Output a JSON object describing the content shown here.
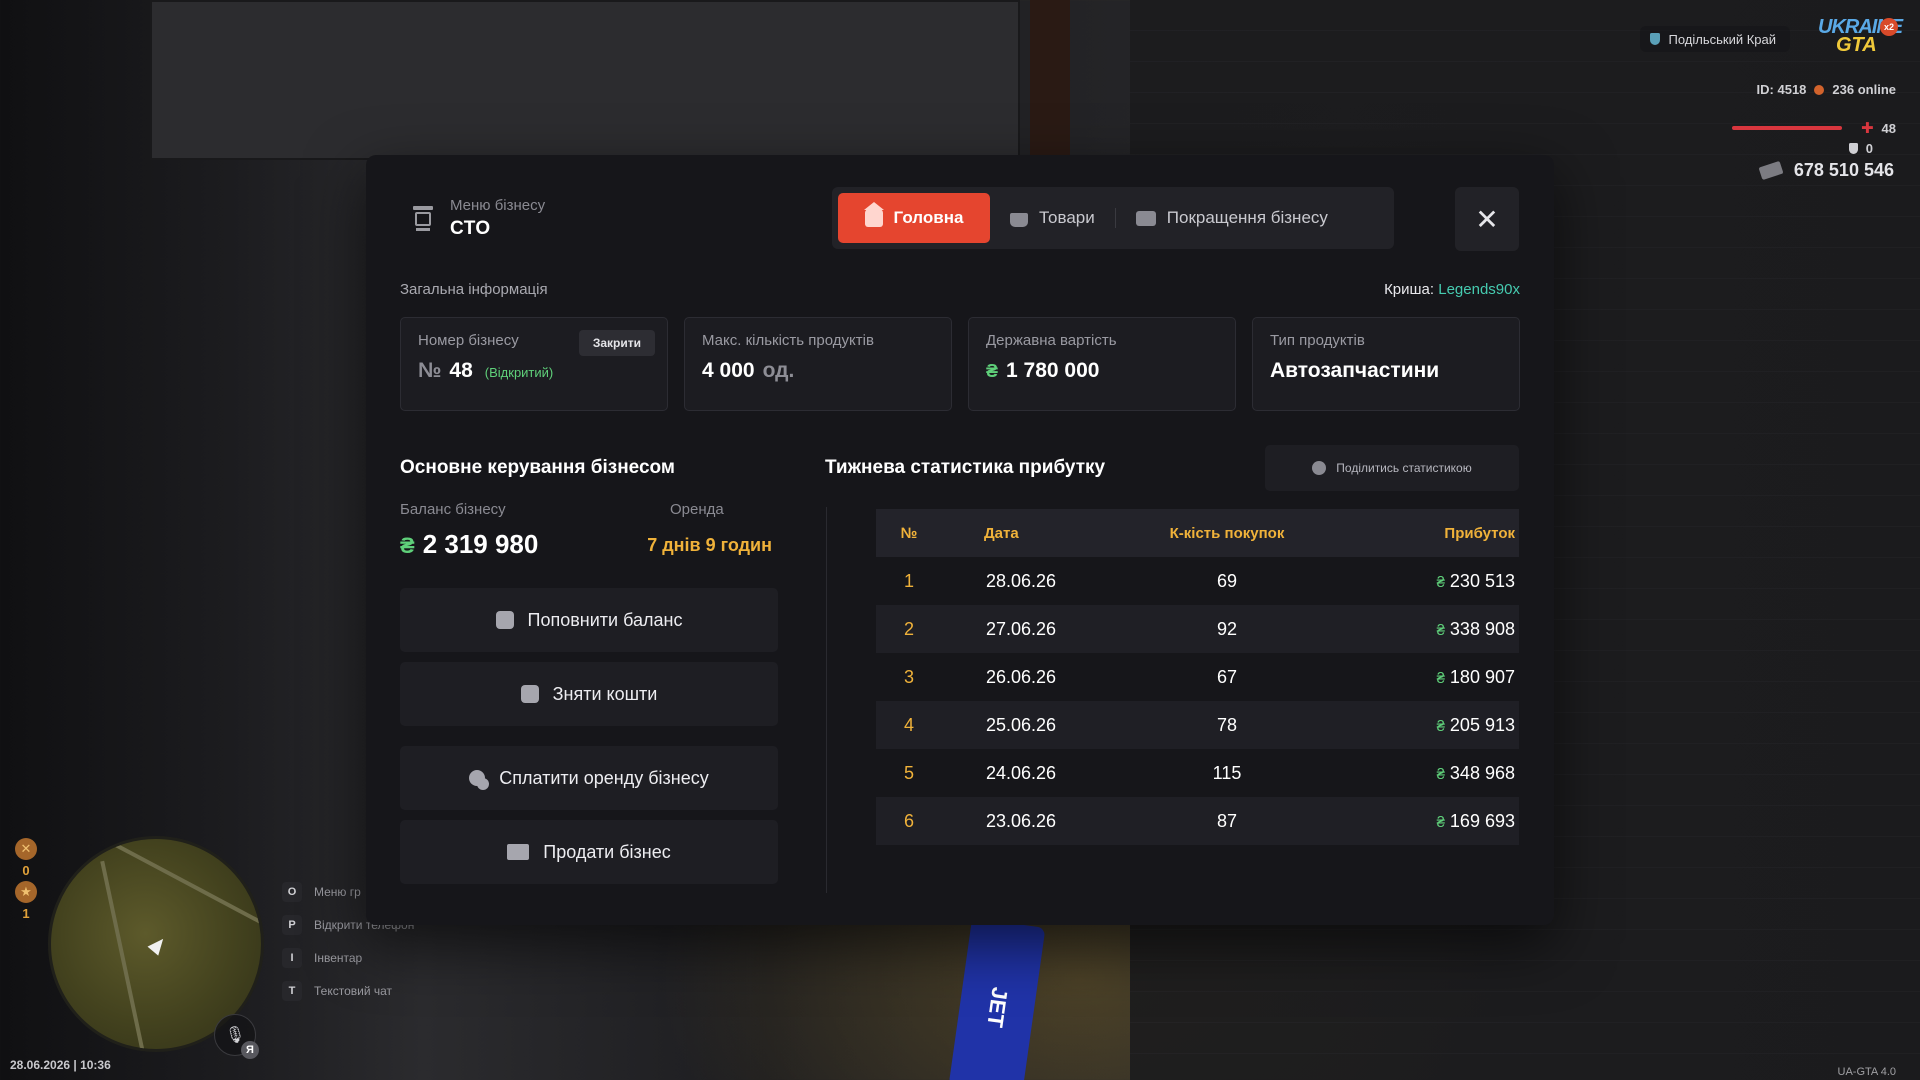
{
  "hud": {
    "server": "Подільський Край",
    "logo_top": "UKRAINE",
    "logo_bottom": "GTA",
    "logo_badge": "x2",
    "player_id": "ID: 4518",
    "online": "236 online",
    "health": "48",
    "health_level_pct": 48,
    "armor": "0",
    "money": "678 510 546",
    "wanted_top": "0",
    "wanted_bottom": "1",
    "mic_lang": "Я",
    "hints": [
      {
        "key": "O",
        "label": "Меню гр"
      },
      {
        "key": "P",
        "label": "Відкрити телефон"
      },
      {
        "key": "I",
        "label": "Інвентар"
      },
      {
        "key": "T",
        "label": "Текстовий чат"
      }
    ],
    "datetime": "28.06.2026 | 10:36",
    "version": "UA-GTA 4.0",
    "background_text": "JET"
  },
  "modal": {
    "subtitle": "Меню бізнесу",
    "title": "СТО",
    "tabs": [
      {
        "label": "Головна",
        "icon": "home-icon",
        "active": true
      },
      {
        "label": "Товари",
        "icon": "basket-icon",
        "active": false
      },
      {
        "label": "Покращення бізнесу",
        "icon": "wallet-icon",
        "active": false
      }
    ],
    "close_icon": "✕",
    "section_label": "Загальна інформація",
    "roof_label": "Криша:",
    "roof_name": "Legends90x",
    "cards": {
      "number": {
        "label": "Номер бізнесу",
        "prefix": "№",
        "value": "48",
        "status": "(Відкритий)",
        "close_button": "Закрити"
      },
      "max_products": {
        "label": "Макс. кількість продуктів",
        "value": "4 000",
        "unit": "од."
      },
      "state_value": {
        "label": "Державна вартість",
        "currency": "₴",
        "value": "1 780 000"
      },
      "product_type": {
        "label": "Тип продуктів",
        "value": "Автозапчастини"
      }
    },
    "control": {
      "heading": "Основне керування бізнесом",
      "balance_label": "Баланс бізнесу",
      "balance_currency": "₴",
      "balance_value": "2 319 980",
      "rent_label": "Оренда",
      "rent_value": "7 днів 9 годин",
      "actions": [
        "Поповнити баланс",
        "Зняти кошти",
        "Сплатити оренду бізнесу",
        "Продати бізнес"
      ]
    },
    "stats": {
      "heading": "Тижнева статистика прибутку",
      "share_label": "Поділитись статистикою",
      "columns": [
        "№",
        "Дата",
        "К-кість покупок",
        "Прибуток"
      ],
      "currency": "₴",
      "rows": [
        {
          "n": "1",
          "date": "28.06.26",
          "purchases": "69",
          "profit": "230 513"
        },
        {
          "n": "2",
          "date": "27.06.26",
          "purchases": "92",
          "profit": "338 908"
        },
        {
          "n": "3",
          "date": "26.06.26",
          "purchases": "67",
          "profit": "180 907"
        },
        {
          "n": "4",
          "date": "25.06.26",
          "purchases": "78",
          "profit": "205 913"
        },
        {
          "n": "5",
          "date": "24.06.26",
          "purchases": "115",
          "profit": "348 968"
        },
        {
          "n": "6",
          "date": "23.06.26",
          "purchases": "87",
          "profit": "169 693"
        }
      ]
    }
  },
  "colors": {
    "accent": "#e5452f",
    "positive": "#5fd07a",
    "highlight": "#f0b23a",
    "roof_name": "#46cbb0",
    "modal_bg": "#16161a"
  }
}
